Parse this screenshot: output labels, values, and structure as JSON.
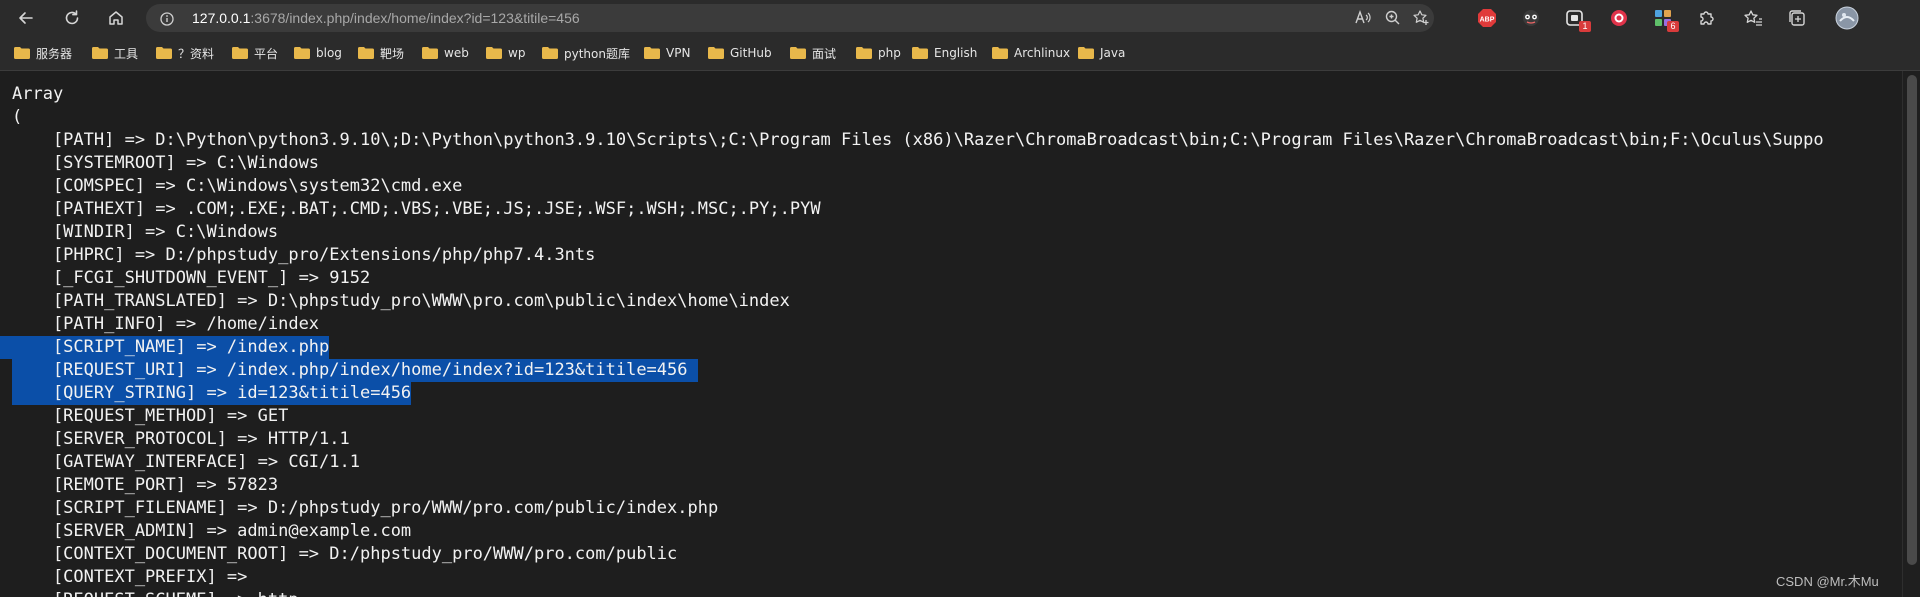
{
  "browser": {
    "url_host": "127.0.0.1",
    "url_rest": ":3678/index.php/index/home/index?id=123&titile=456",
    "extension_badges": [
      "1",
      "6"
    ],
    "accent_color": "#0b4fa8",
    "icons": [
      "back-icon",
      "refresh-icon",
      "home-icon",
      "info-icon",
      "read-aloud-icon",
      "zoom-icon",
      "favorite-add-icon",
      "abp-icon",
      "extension-icon",
      "favorites-icon",
      "collections-icon",
      "profile-avatar"
    ]
  },
  "bookmarks": [
    "服务器",
    "工具",
    "？资料",
    "平台",
    "blog",
    "靶场",
    "web",
    "wp",
    "python题库",
    "VPN",
    "GitHub",
    "面试",
    "php",
    "English",
    "Archlinux",
    "Java"
  ],
  "content": {
    "lines": [
      "Array",
      "(",
      "    [PATH] => D:\\Python\\python3.9.10\\;D:\\Python\\python3.9.10\\Scripts\\;C:\\Program Files (x86)\\Razer\\ChromaBroadcast\\bin;C:\\Program Files\\Razer\\ChromaBroadcast\\bin;F:\\Oculus\\Suppo",
      "    [SYSTEMROOT] => C:\\Windows",
      "    [COMSPEC] => C:\\Windows\\system32\\cmd.exe",
      "    [PATHEXT] => .COM;.EXE;.BAT;.CMD;.VBS;.VBE;.JS;.JSE;.WSF;.WSH;.MSC;.PY;.PYW",
      "    [WINDIR] => C:\\Windows",
      "    [PHPRC] => D:/phpstudy_pro/Extensions/php/php7.4.3nts",
      "    [_FCGI_SHUTDOWN_EVENT_] => 9152",
      "    [PATH_TRANSLATED] => D:\\phpstudy_pro\\WWW\\pro.com\\public\\index\\home\\index",
      "    [PATH_INFO] => /home/index",
      "    [SCRIPT_NAME] => /index.php",
      "    [REQUEST_URI] => /index.php/index/home/index?id=123&titile=456 ",
      "    [QUERY_STRING] => id=123&titile=456",
      "    [REQUEST_METHOD] => GET",
      "    [SERVER_PROTOCOL] => HTTP/1.1",
      "    [GATEWAY_INTERFACE] => CGI/1.1",
      "    [REMOTE_PORT] => 57823",
      "    [SCRIPT_FILENAME] => D:/phpstudy_pro/WWW/pro.com/public/index.php",
      "    [SERVER_ADMIN] => admin@example.com",
      "    [CONTEXT_DOCUMENT_ROOT] => D:/phpstudy_pro/WWW/pro.com/public",
      "    [CONTEXT_PREFIX] =>",
      "    [REQUEST_SCHEME] => http"
    ]
  },
  "watermark": "CSDN @Mr.木Mu"
}
